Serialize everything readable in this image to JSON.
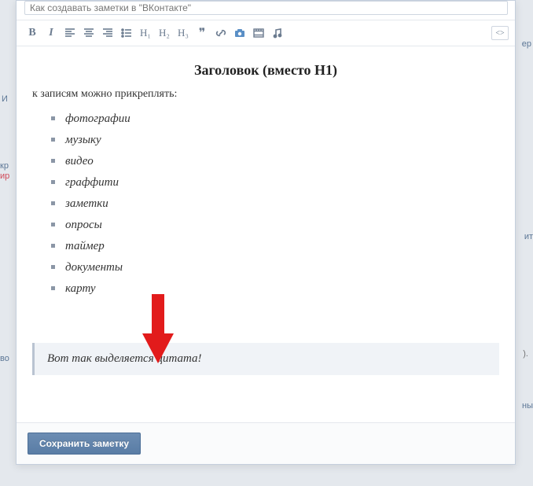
{
  "titleInput": {
    "value": "Как создавать заметки в \"ВКонтакте\""
  },
  "toolbar": {
    "bold": "B",
    "h1": "H₁",
    "h2": "H₂",
    "h3": "H₃",
    "quote": "❝"
  },
  "content": {
    "heading": "Заголовок (вместо H1)",
    "intro": "к записям можно прикреплять:",
    "items": [
      "фотографии",
      "музыку",
      "видео",
      "граффити",
      "заметки",
      "опросы",
      "таймер",
      "документы",
      "карту"
    ],
    "quote": "Вот так выделяется цитата!"
  },
  "footer": {
    "saveLabel": "Сохранить заметку"
  }
}
